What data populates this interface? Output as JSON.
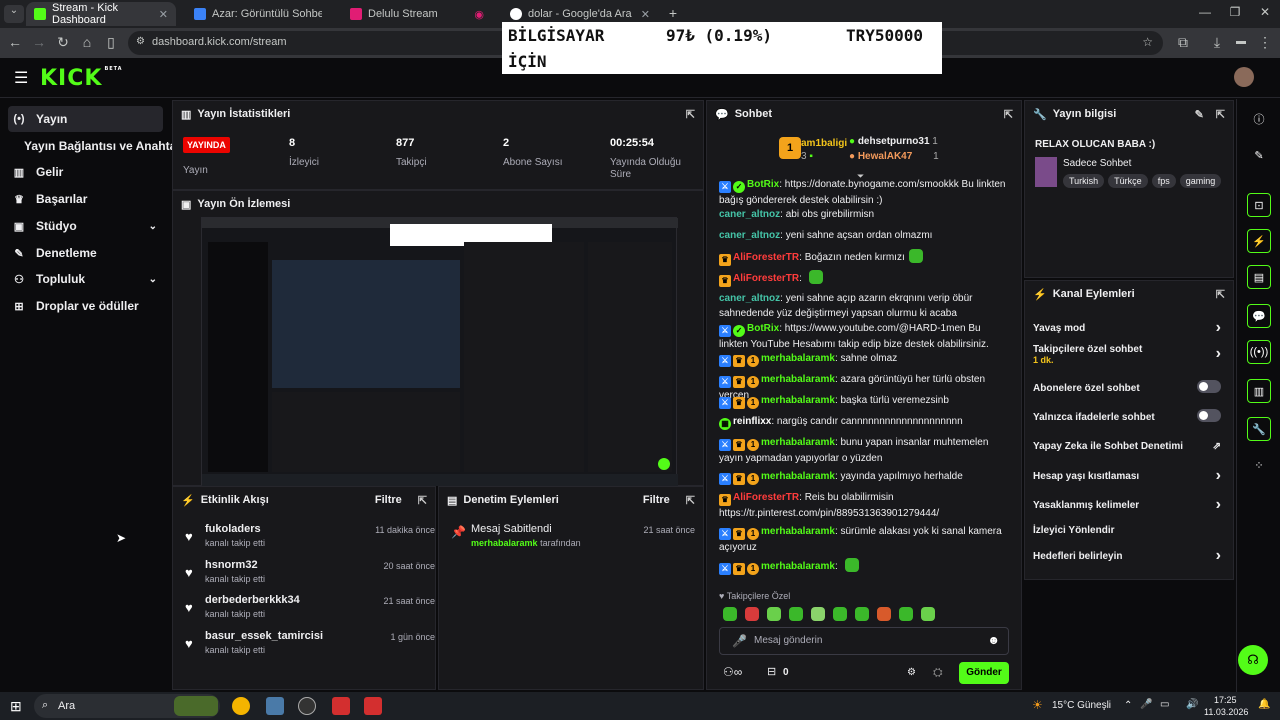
{
  "browser": {
    "tabs": [
      {
        "label": "Stream - Kick Dashboard",
        "color": "#53fc18"
      },
      {
        "label": "Azar: Görüntülü Sohbet & V",
        "color": "#3b82f6"
      },
      {
        "label": "Delulu Stream",
        "color": "#e11d74"
      },
      {
        "label": "dolar - Google'da Ara",
        "color": "#ffffff"
      }
    ],
    "url": "dashboard.kick.com/stream"
  },
  "popup": {
    "line1_left": "BİLGİSAYAR",
    "line1_mid": "97₺ (0.19%)",
    "line1_right": "TRY50000",
    "line2": "İÇİN"
  },
  "logo": "KICK",
  "logo_sup": "BETA",
  "nav": [
    {
      "label": "Yayın",
      "icon": "broadcast-icon",
      "active": true
    },
    {
      "label": "Yayın Bağlantısı ve Anahtarı",
      "icon": ""
    },
    {
      "label": "Gelir",
      "icon": "chart-icon"
    },
    {
      "label": "Başarılar",
      "icon": "trophy-icon"
    },
    {
      "label": "Stüdyo",
      "icon": "studio-icon",
      "chev": "⌄"
    },
    {
      "label": "Denetleme",
      "icon": "wrench-icon"
    },
    {
      "label": "Topluluk",
      "icon": "people-icon",
      "chev": "⌄"
    },
    {
      "label": "Droplar ve ödüller",
      "icon": "gift-icon"
    }
  ],
  "stats": {
    "title": "Yayın İstatistikleri",
    "live_badge": "YAYINDA",
    "live_label": "Yayın",
    "items": [
      {
        "value": "8",
        "label": "İzleyici"
      },
      {
        "value": "877",
        "label": "Takipçi"
      },
      {
        "value": "2",
        "label": "Abone Sayısı"
      },
      {
        "value": "00:25:54",
        "label": "Yayında Olduğu Süre"
      }
    ]
  },
  "preview": {
    "title": "Yayın Ön İzlemesi"
  },
  "activity": {
    "title": "Etkinlik Akışı",
    "filter": "Filtre",
    "items": [
      {
        "name": "fukoladers",
        "sub": "kanalı takip etti",
        "time": "11 dakika önce"
      },
      {
        "name": "hsnorm32",
        "sub": "kanalı takip etti",
        "time": "20 saat önce"
      },
      {
        "name": "derbederberkkk34",
        "sub": "kanalı takip etti",
        "time": "21 saat önce"
      },
      {
        "name": "basur_essek_tamircisi",
        "sub": "kanalı takip etti",
        "time": "1 gün önce"
      }
    ]
  },
  "modactions": {
    "title": "Denetim Eylemleri",
    "filter": "Filtre",
    "items": [
      {
        "title": "Mesaj Sabitlendi",
        "user": "merhabalaramk",
        "suffix": "tarafından",
        "time": "21 saat önce"
      }
    ]
  },
  "chat": {
    "title": "Sohbet",
    "top": [
      {
        "name": "am1baligi",
        "count": "3",
        "rank": "1"
      },
      {
        "name": "dehsetpurno31",
        "count": "1"
      },
      {
        "name": "HewalAK47",
        "count": "1"
      }
    ],
    "messages": [
      {
        "badges": [
          "mod",
          "v"
        ],
        "user": "BotRix",
        "ucolor": "#53fc18",
        "text": "https://donate.bynogame.com/smookkk Bu linkten bağış göndererek destek olabilirsin :)",
        "link": true
      },
      {
        "badges": [],
        "user": "caner_altnoz",
        "ucolor": "#45c4a8",
        "text": "abi obs girebilirmisn"
      },
      {
        "badges": [],
        "user": "caner_altnoz",
        "ucolor": "#45c4a8",
        "text": "yeni sahne açsan ordan olmazmı"
      },
      {
        "badges": [
          "crown"
        ],
        "user": "AliForesterTR",
        "ucolor": "#ff3c3c",
        "text": "Boğazın neden kırmızı",
        "emote": true
      },
      {
        "badges": [
          "crown"
        ],
        "user": "AliForesterTR",
        "ucolor": "#ff3c3c",
        "text": "",
        "emote": true
      },
      {
        "badges": [],
        "user": "caner_altnoz",
        "ucolor": "#45c4a8",
        "text": "yeni sahne açıp azarın ekrqnını verip öbür sahnedende yüz değiştirmeyi yapsan olurmu ki acaba"
      },
      {
        "badges": [
          "mod",
          "v"
        ],
        "user": "BotRix",
        "ucolor": "#53fc18",
        "text": "https://www.youtube.com/@HARD-1men Bu linkten YouTube Hesabımı takip edip bize destek olabilirsiniz."
      },
      {
        "badges": [
          "mod",
          "crown",
          "one"
        ],
        "user": "merhabalaramk",
        "ucolor": "#53fc18",
        "text": "sahne olmaz"
      },
      {
        "badges": [
          "mod",
          "crown",
          "one"
        ],
        "user": "merhabalaramk",
        "ucolor": "#53fc18",
        "text": "azara görüntüyü her türlü obsten vercen"
      },
      {
        "badges": [
          "mod",
          "crown",
          "one"
        ],
        "user": "merhabalaramk",
        "ucolor": "#53fc18",
        "text": "başka türlü veremezsinb"
      },
      {
        "badges": [
          "grid"
        ],
        "user": "reinflixx",
        "ucolor": "#fff",
        "text": "nargüş candır cannnnnnnnnnnnnnnnnnnn"
      },
      {
        "badges": [
          "mod",
          "crown",
          "one"
        ],
        "user": "merhabalaramk",
        "ucolor": "#53fc18",
        "text": "bunu yapan insanlar muhtemelen yayın yapmadan yapıyorlar o yüzden"
      },
      {
        "badges": [
          "mod",
          "crown",
          "one"
        ],
        "user": "merhabalaramk",
        "ucolor": "#53fc18",
        "text": "yayında yapılmıyo herhalde"
      },
      {
        "badges": [
          "crown"
        ],
        "user": "AliForesterTR",
        "ucolor": "#ff3c3c",
        "text": "Reis bu olabilirmisin https://tr.pinterest.com/pin/889531363901279444/"
      },
      {
        "badges": [
          "mod",
          "crown",
          "one"
        ],
        "user": "merhabalaramk",
        "ucolor": "#53fc18",
        "text": "sürümle alakası yok ki sanal kamera açıyoruz"
      },
      {
        "badges": [
          "mod",
          "crown",
          "one"
        ],
        "user": "merhabalaramk",
        "ucolor": "#53fc18",
        "text": "",
        "emote": true
      }
    ],
    "emote_label": "Takipçilere Özel",
    "emote_colors": [
      "#3bb82a",
      "#d83b3b",
      "#6ad04b",
      "#3bb82a",
      "#8ad36b",
      "#3bb82a",
      "#3bb82a",
      "#d85a2b",
      "#3bb82a",
      "#6ad04b"
    ],
    "input_placeholder": "Mesaj gönderin",
    "points": "0",
    "send": "Gönder"
  },
  "info": {
    "title": "Yayın bilgisi",
    "stream_title": "RELAX OLUCAN BABA :)",
    "category": "Sadece Sohbet",
    "tags": [
      "Turkish",
      "Türkçe",
      "fps",
      "gaming"
    ]
  },
  "channel_actions": {
    "title": "Kanal Eylemleri",
    "items": [
      {
        "label": "Yavaş mod",
        "type": "chev"
      },
      {
        "label": "Takipçilere özel sohbet",
        "type": "chev",
        "sub": "1 dk."
      },
      {
        "label": "Abonelere özel sohbet",
        "type": "toggle"
      },
      {
        "label": "Yalnızca ifadelerle sohbet",
        "type": "toggle"
      },
      {
        "label": "Yapay Zeka ile Sohbet Denetimi",
        "type": "ext"
      },
      {
        "label": "Hesap yaşı kısıtlaması",
        "type": "chev"
      },
      {
        "label": "Yasaklanmış kelimeler",
        "type": "chev"
      },
      {
        "label": "İzleyici Yönlendir",
        "type": "none"
      },
      {
        "label": "Hedefleri belirleyin",
        "type": "chev"
      }
    ]
  },
  "taskbar": {
    "search": "Ara",
    "weather": "15°C Güneşli",
    "time": "17:25",
    "date": "11.03.2026"
  },
  "colors": {
    "brand": "#53fc18",
    "bg": "#0b0b0d",
    "panel": "#18181b",
    "live": "#eb0400"
  }
}
